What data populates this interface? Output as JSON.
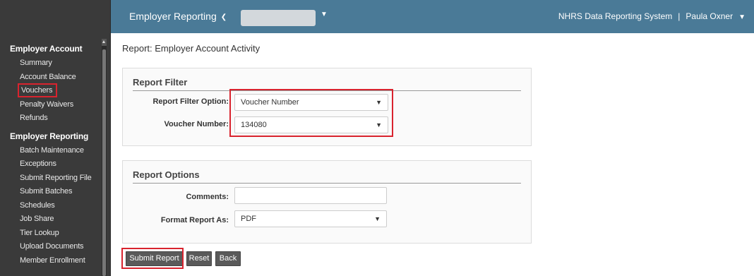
{
  "header": {
    "nav_label": "Employer Reporting",
    "employer_value": "",
    "system_name": "NHRS Data Reporting System",
    "separator": "|",
    "user_name": "Paula Oxner"
  },
  "sidebar": {
    "sections": [
      {
        "title": "Employer Account",
        "items": [
          "Summary",
          "Account Balance",
          "Vouchers",
          "Penalty Waivers",
          "Refunds"
        ]
      },
      {
        "title": "Employer Reporting",
        "items": [
          "Batch Maintenance",
          "Exceptions",
          "Submit Reporting File",
          "Submit Batches",
          "Schedules",
          "Job Share",
          "Tier Lookup",
          "Upload Documents",
          "Member Enrollment"
        ]
      }
    ],
    "highlighted_item": "Vouchers"
  },
  "page": {
    "title": "Report: Employer Account Activity"
  },
  "report_filter": {
    "title": "Report Filter",
    "filter_option_label": "Report Filter Option:",
    "filter_option_value": "Voucher Number",
    "voucher_number_label": "Voucher Number:",
    "voucher_number_value": "134080"
  },
  "report_options": {
    "title": "Report Options",
    "comments_label": "Comments:",
    "comments_value": "",
    "format_label": "Format Report As:",
    "format_value": "PDF"
  },
  "buttons": {
    "submit": "Submit Report",
    "reset": "Reset",
    "back": "Back"
  },
  "icons": {
    "chevron": "chevron-down-icon"
  },
  "colors": {
    "topbar": "#4a7a97",
    "sidebar": "#3a3a3a",
    "highlight": "#d9232e",
    "button": "#5a5a5a"
  }
}
